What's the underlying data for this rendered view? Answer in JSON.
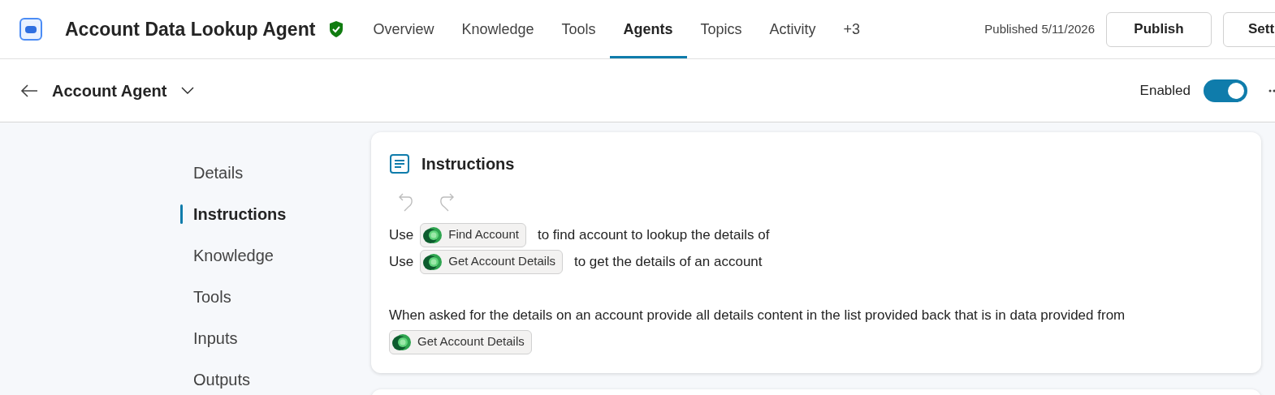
{
  "header": {
    "title": "Account Data Lookup Agent",
    "verified": true,
    "tabs": [
      {
        "label": "Overview",
        "selected": false
      },
      {
        "label": "Knowledge",
        "selected": false
      },
      {
        "label": "Tools",
        "selected": false
      },
      {
        "label": "Agents",
        "selected": true
      },
      {
        "label": "Topics",
        "selected": false
      },
      {
        "label": "Activity",
        "selected": false
      },
      {
        "label": "+3",
        "selected": false
      }
    ],
    "published": "Published 5/11/2026",
    "buttons": [
      "Publish",
      "Sett"
    ]
  },
  "subheader": {
    "title": "Account Agent",
    "toggle_label": "Enabled",
    "enabled": true
  },
  "side_nav": [
    {
      "label": "Details",
      "selected": false
    },
    {
      "label": "Instructions",
      "selected": true
    },
    {
      "label": "Knowledge",
      "selected": false
    },
    {
      "label": "Tools",
      "selected": false
    },
    {
      "label": "Inputs",
      "selected": false
    },
    {
      "label": "Outputs",
      "selected": false
    }
  ],
  "card": {
    "title": "Instructions",
    "paragraphs": [
      [
        {
          "kind": "text",
          "text": "Use"
        },
        {
          "kind": "tool",
          "text": "Find Account"
        },
        {
          "kind": "text",
          "text": "to find account to lookup the details of"
        }
      ],
      [
        {
          "kind": "text",
          "text": "Use"
        },
        {
          "kind": "tool",
          "text": "Get Account Details"
        },
        {
          "kind": "text",
          "text": "to get the details of an account"
        }
      ],
      [
        {
          "kind": "gap"
        }
      ],
      [
        {
          "kind": "text",
          "text": "When asked for the details on an account provide all details content in the list provided back that is in data provided from"
        }
      ],
      [
        {
          "kind": "tool",
          "text": "Get Account Details"
        }
      ]
    ]
  }
}
